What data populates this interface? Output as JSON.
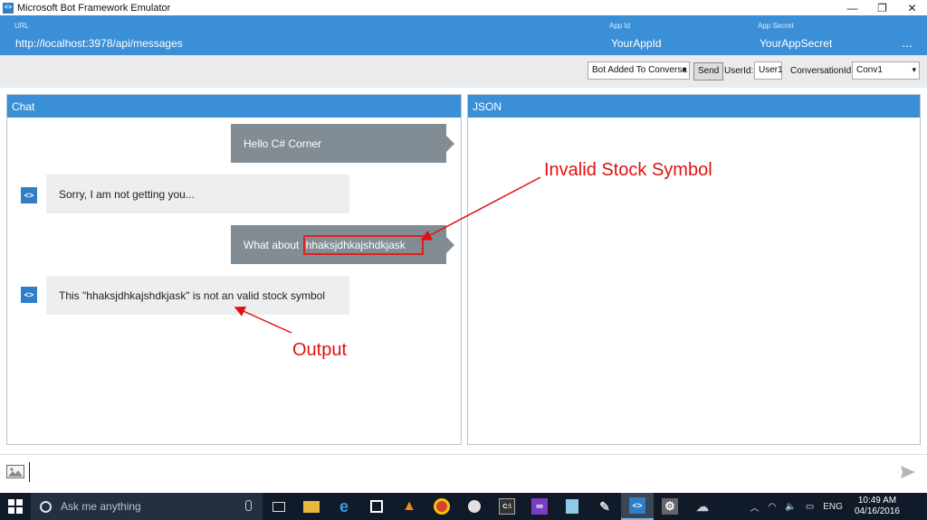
{
  "window": {
    "title": "Microsoft Bot Framework Emulator",
    "minimize": "—",
    "restore": "❐",
    "close": "✕"
  },
  "header": {
    "url_label": "URL",
    "url_value": "http://localhost:3978/api/messages",
    "appid_label": "App Id",
    "appid_value": "YourAppId",
    "appsecret_label": "App Secret",
    "appsecret_value": "YourAppSecret",
    "more": "..."
  },
  "toolbar": {
    "message_type": "Bot Added To Conversa",
    "send_label": "Send",
    "userid_label": "UserId:",
    "userid_value": "User1",
    "conversationid_label": "ConversationId:",
    "conversationid_value": "Conv1"
  },
  "chat": {
    "title": "Chat",
    "messages": [
      {
        "from": "user",
        "text": "Hello C# Corner"
      },
      {
        "from": "bot",
        "text": "Sorry, I am not getting you..."
      },
      {
        "from": "user",
        "prefix": "What about ",
        "highlight": "hhaksjdhkajshdkjask"
      },
      {
        "from": "bot",
        "text": "This \"hhaksjdhkajshdkjask\" is not an valid stock symbol"
      }
    ]
  },
  "json_panel": {
    "title": "JSON"
  },
  "annotations": {
    "invalid": "Invalid Stock Symbol",
    "output": "Output"
  },
  "input": {
    "placeholder": ""
  },
  "taskbar": {
    "search_placeholder": "Ask me anything",
    "language": "ENG",
    "time": "10:49 AM",
    "date": "04/16/2016"
  },
  "colors": {
    "accent": "#3b8fd6",
    "user_bubble": "#818c95",
    "bot_bubble": "#eceef0",
    "annotation": "#e01010"
  }
}
